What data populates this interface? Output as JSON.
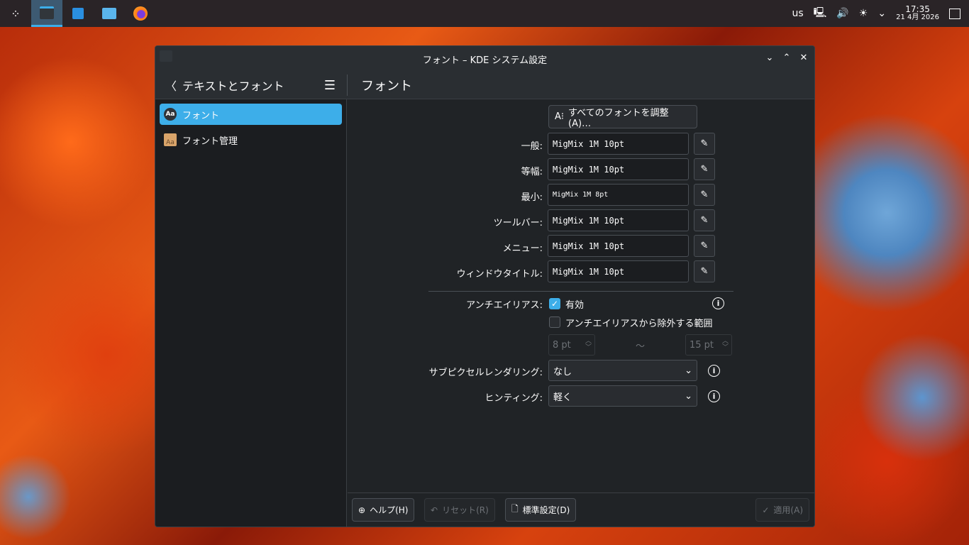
{
  "taskbar": {
    "apps": [
      "launcher-icon",
      "system-settings-icon",
      "discover-icon",
      "file-manager-icon",
      "firefox-icon"
    ],
    "keyboard_layout": "us",
    "time": "17:35",
    "date": "21 4月 2026"
  },
  "window": {
    "title": "フォント – KDE システム設定",
    "back_label": "テキストとフォント",
    "page_title": "フォント"
  },
  "sidebar": {
    "items": [
      {
        "label": "フォント",
        "icon_text": "Aa"
      },
      {
        "label": "フォント管理",
        "icon_text": "Aa"
      }
    ]
  },
  "main": {
    "adjust_all": "すべてのフォントを調整(A)…",
    "fonts": [
      {
        "label": "一般:",
        "value": "MigMix 1M 10pt"
      },
      {
        "label": "等幅:",
        "value": "MigMix 1M 10pt"
      },
      {
        "label": "最小:",
        "value": "MigMix 1M 8pt"
      },
      {
        "label": "ツールバー:",
        "value": "MigMix 1M 10pt"
      },
      {
        "label": "メニュー:",
        "value": "MigMix 1M 10pt"
      },
      {
        "label": "ウィンドウタイトル:",
        "value": "MigMix 1M 10pt"
      }
    ],
    "antialias_label": "アンチエイリアス:",
    "antialias_enabled": "有効",
    "antialias_checked": true,
    "exclude_label": "アンチエイリアスから除外する範囲",
    "exclude_checked": false,
    "range_from": "8 pt",
    "range_sep": "〜",
    "range_to": "15 pt",
    "subpixel_label": "サブピクセルレンダリング:",
    "subpixel_value": "なし",
    "hinting_label": "ヒンティング:",
    "hinting_value": "軽く"
  },
  "footer": {
    "help": "ヘルプ(H)",
    "reset": "リセット(R)",
    "defaults": "標準設定(D)",
    "apply": "適用(A)"
  },
  "colors": {
    "accent": "#3daee9",
    "bg": "#202326"
  }
}
